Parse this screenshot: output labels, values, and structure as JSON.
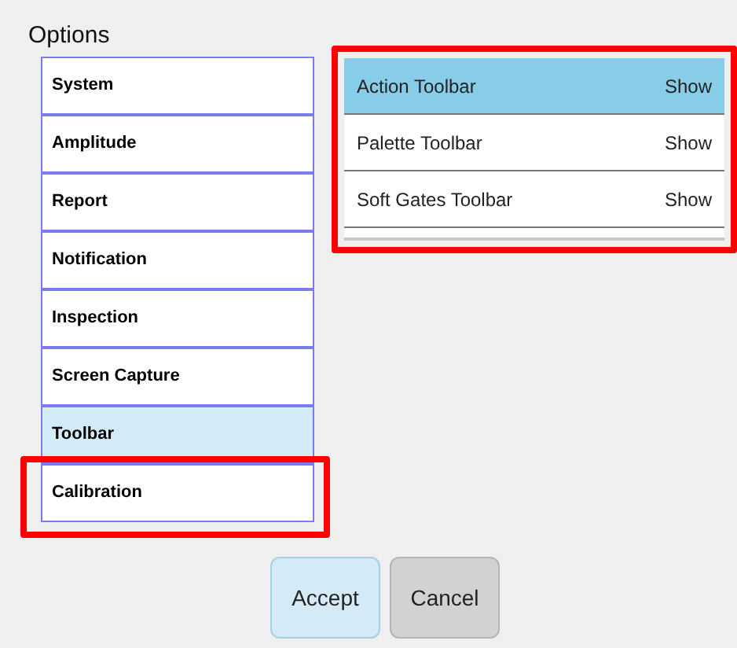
{
  "title": "Options",
  "categories": [
    {
      "label": "System",
      "selected": false,
      "highlighted": false
    },
    {
      "label": "Amplitude",
      "selected": false,
      "highlighted": false
    },
    {
      "label": "Report",
      "selected": false,
      "highlighted": false
    },
    {
      "label": "Notification",
      "selected": false,
      "highlighted": false
    },
    {
      "label": "Inspection",
      "selected": false,
      "highlighted": false
    },
    {
      "label": "Screen Capture",
      "selected": false,
      "highlighted": false
    },
    {
      "label": "Toolbar",
      "selected": true,
      "highlighted": false
    },
    {
      "label": "Calibration",
      "selected": false,
      "highlighted": true
    }
  ],
  "toolbars": {
    "highlighted": true,
    "rows": [
      {
        "name": "Action Toolbar",
        "value": "Show",
        "selected": true
      },
      {
        "name": "Palette Toolbar",
        "value": "Show",
        "selected": false
      },
      {
        "name": "Soft Gates Toolbar",
        "value": "Show",
        "selected": false
      }
    ]
  },
  "buttons": [
    {
      "label": "Accept",
      "kind": "primary"
    },
    {
      "label": "Cancel",
      "kind": "secondary"
    }
  ]
}
